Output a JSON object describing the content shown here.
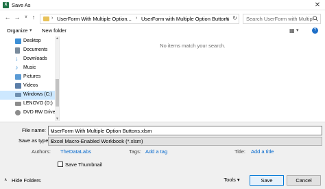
{
  "window": {
    "title": "Save As",
    "app_icon_letter": "X",
    "close_glyph": "✕"
  },
  "nav": {
    "back": "←",
    "forward": "→",
    "up_dropdown": "∨",
    "up": "↑"
  },
  "address": {
    "segments": [
      "UserForm With Multiple Option...",
      "UserForm with Multiple Option Buttons"
    ],
    "separator": "›",
    "dropdown": "∨",
    "refresh": "↻"
  },
  "search": {
    "placeholder": "Search UserForm with Multipl..."
  },
  "toolbar": {
    "organize_label": "Organize",
    "organize_caret": "▾",
    "new_folder_label": "New folder",
    "view_icon": "▦",
    "view_caret": "▾",
    "help_icon": "?"
  },
  "sidebar": {
    "items": [
      {
        "label": "Desktop",
        "icon": "desktop-icon",
        "color": "#3c8fd6"
      },
      {
        "label": "Documents",
        "icon": "documents-icon",
        "color": "#7a8b9c"
      },
      {
        "label": "Downloads",
        "icon": "downloads-icon",
        "color": "#3c8fd6"
      },
      {
        "label": "Music",
        "icon": "music-icon",
        "color": "#3c8fd6"
      },
      {
        "label": "Pictures",
        "icon": "pictures-icon",
        "color": "#5b9bd5"
      },
      {
        "label": "Videos",
        "icon": "videos-icon",
        "color": "#5b7ea8"
      },
      {
        "label": "Windows (C:)",
        "icon": "drive-icon",
        "color": "#6f8fb0"
      },
      {
        "label": "LENOVO (D:)",
        "icon": "drive-icon",
        "color": "#8c8c8c"
      },
      {
        "label": "DVD RW Drive",
        "icon": "dvd-icon",
        "color": "#8c8c8c"
      }
    ],
    "selected_index": 6
  },
  "content": {
    "empty_message": "No items match your search."
  },
  "form": {
    "file_name_label": "File name:",
    "file_name_value": "UserForm With Multiple Option Buttons.xlsm",
    "save_type_label": "Save as type:",
    "save_type_value": "Excel Macro-Enabled Workbook (*.xlsm)",
    "authors_label": "Authors:",
    "authors_value": "TheDataLabs",
    "tags_label": "Tags:",
    "tags_value": "Add a tag",
    "title_label": "Title:",
    "title_value": "Add a title",
    "thumbnail_label": "Save Thumbnail",
    "thumbnail_checked": false
  },
  "footer": {
    "hide_folders_label": "Hide Folders",
    "hide_folders_caret": "∧",
    "tools_label": "Tools",
    "tools_caret": "▾",
    "save_label": "Save",
    "cancel_label": "Cancel"
  },
  "colors": {
    "accent": "#0078d7",
    "link": "#0066cc",
    "selected_bg": "#cde8ff",
    "excel_green": "#1e7145",
    "folder": "#e8c25a"
  }
}
